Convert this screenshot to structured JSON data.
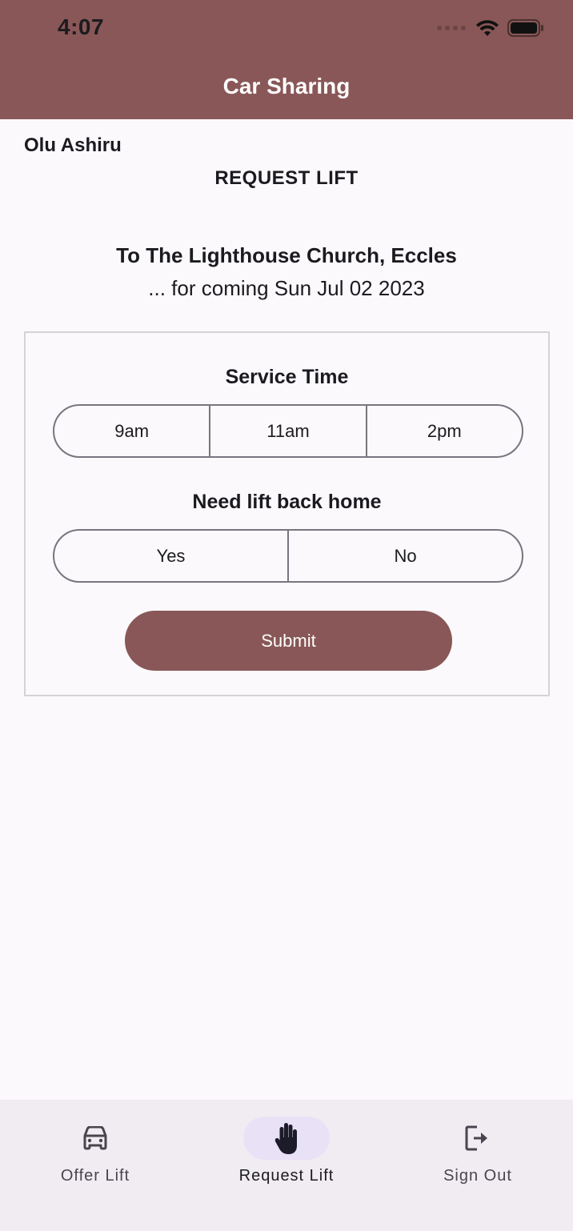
{
  "status_bar": {
    "time": "4:07"
  },
  "app_bar": {
    "title": "Car Sharing",
    "color": "#895757"
  },
  "user": {
    "name": "Olu Ashiru"
  },
  "page": {
    "heading": "REQUEST LIFT",
    "destination": "To The Lighthouse Church, Eccles",
    "date_line": "... for coming Sun Jul 02 2023"
  },
  "form": {
    "service_time": {
      "label": "Service Time",
      "options": [
        "9am",
        "11am",
        "2pm"
      ]
    },
    "lift_back": {
      "label": "Need lift back home",
      "options": [
        "Yes",
        "No"
      ]
    },
    "submit_label": "Submit"
  },
  "bottom_nav": {
    "items": [
      {
        "label": "Offer Lift",
        "icon": "car-icon",
        "active": false
      },
      {
        "label": "Request Lift",
        "icon": "hand-icon",
        "active": true
      },
      {
        "label": "Sign Out",
        "icon": "logout-icon",
        "active": false
      }
    ]
  }
}
